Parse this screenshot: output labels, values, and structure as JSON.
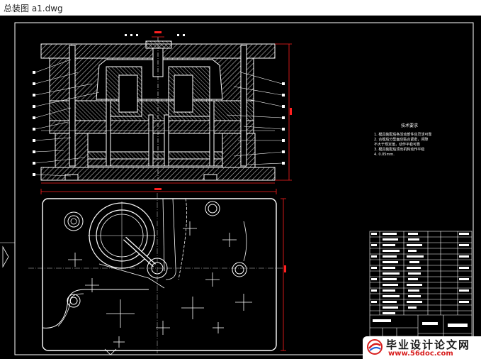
{
  "window": {
    "title": "总装图 a1.dwg"
  },
  "drawing": {
    "background": "#000000",
    "line_color": "#ffffff",
    "dimension_color": "#ff2020",
    "hatch_color": "#c8c8c8",
    "notes": {
      "title": "技术要求",
      "lines": [
        "1. 模具装配后各活动部件应灵活可靠",
        "2. 合模后分型面应贴合紧密，间隙",
        "   不大于规定值，动作平稳可靠",
        "3. 模具装配后顶出机构动作平稳",
        "4. 0.05mm."
      ]
    }
  },
  "watermark": {
    "name": "毕业设计论文网",
    "url": "www.56doc.com",
    "logo_icon": "globe-logo-icon",
    "accent": "#d81e1e"
  }
}
